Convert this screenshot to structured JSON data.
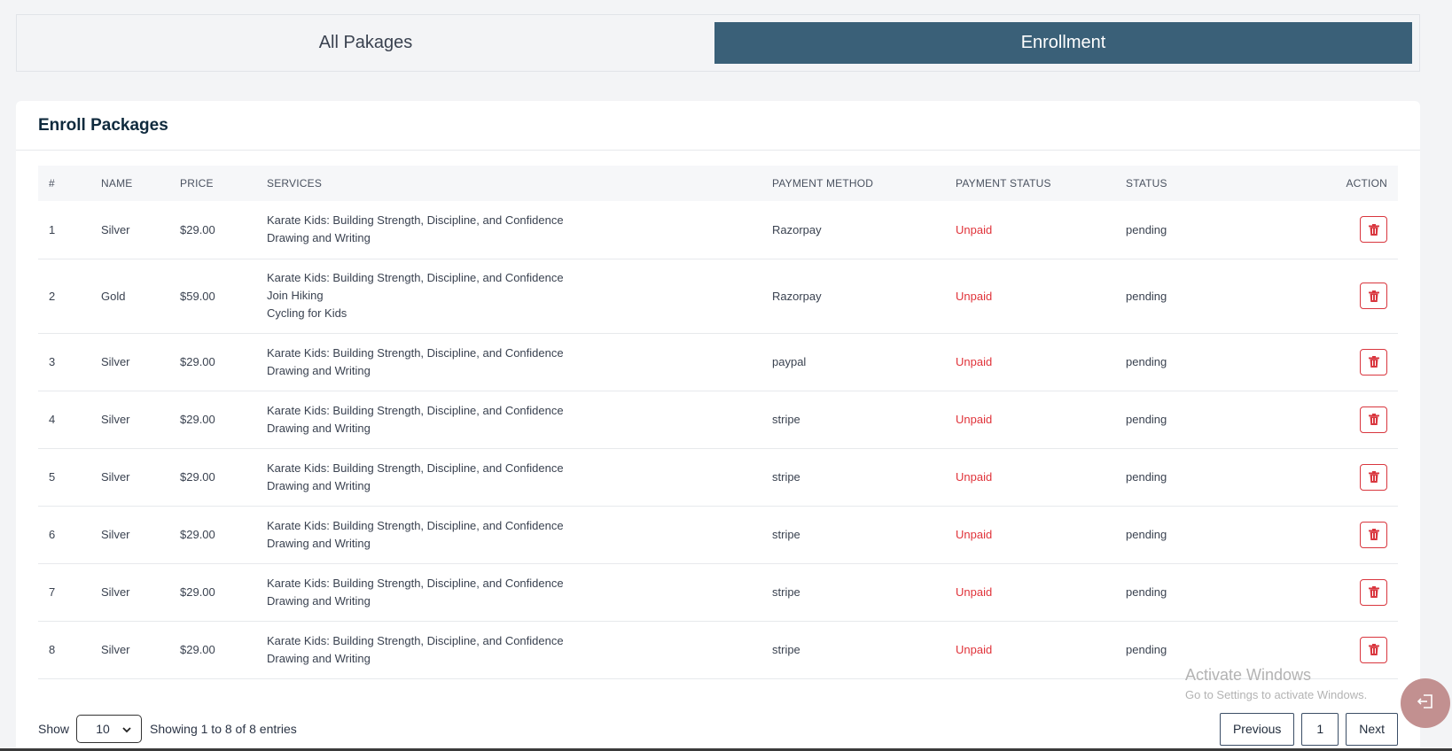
{
  "tabs": [
    {
      "label": "All Pakages",
      "active": false
    },
    {
      "label": "Enrollment",
      "active": true
    }
  ],
  "card": {
    "title": "Enroll Packages"
  },
  "table": {
    "headers": [
      "#",
      "NAME",
      "PRICE",
      "SERVICES",
      "PAYMENT METHOD",
      "PAYMENT STATUS",
      "STATUS",
      "ACTION"
    ],
    "rows": [
      {
        "num": "1",
        "name": "Silver",
        "price": "$29.00",
        "services": [
          "Karate Kids: Building Strength, Discipline, and Confidence",
          "Drawing and Writing"
        ],
        "method": "Razorpay",
        "payment_status": "Unpaid",
        "status": "pending"
      },
      {
        "num": "2",
        "name": "Gold",
        "price": "$59.00",
        "services": [
          "Karate Kids: Building Strength, Discipline, and Confidence",
          "Join Hiking",
          "Cycling for Kids"
        ],
        "method": "Razorpay",
        "payment_status": "Unpaid",
        "status": "pending"
      },
      {
        "num": "3",
        "name": "Silver",
        "price": "$29.00",
        "services": [
          "Karate Kids: Building Strength, Discipline, and Confidence",
          "Drawing and Writing"
        ],
        "method": "paypal",
        "payment_status": "Unpaid",
        "status": "pending"
      },
      {
        "num": "4",
        "name": "Silver",
        "price": "$29.00",
        "services": [
          "Karate Kids: Building Strength, Discipline, and Confidence",
          "Drawing and Writing"
        ],
        "method": "stripe",
        "payment_status": "Unpaid",
        "status": "pending"
      },
      {
        "num": "5",
        "name": "Silver",
        "price": "$29.00",
        "services": [
          "Karate Kids: Building Strength, Discipline, and Confidence",
          "Drawing and Writing"
        ],
        "method": "stripe",
        "payment_status": "Unpaid",
        "status": "pending"
      },
      {
        "num": "6",
        "name": "Silver",
        "price": "$29.00",
        "services": [
          "Karate Kids: Building Strength, Discipline, and Confidence",
          "Drawing and Writing"
        ],
        "method": "stripe",
        "payment_status": "Unpaid",
        "status": "pending"
      },
      {
        "num": "7",
        "name": "Silver",
        "price": "$29.00",
        "services": [
          "Karate Kids: Building Strength, Discipline, and Confidence",
          "Drawing and Writing"
        ],
        "method": "stripe",
        "payment_status": "Unpaid",
        "status": "pending"
      },
      {
        "num": "8",
        "name": "Silver",
        "price": "$29.00",
        "services": [
          "Karate Kids: Building Strength, Discipline, and Confidence",
          "Drawing and Writing"
        ],
        "method": "stripe",
        "payment_status": "Unpaid",
        "status": "pending"
      }
    ],
    "action_icon": "trash-icon"
  },
  "footer": {
    "show_label": "Show",
    "page_size": "10",
    "info": "Showing 1 to 8 of 8 entries",
    "prev_label": "Previous",
    "current_page": "1",
    "next_label": "Next"
  },
  "watermark": {
    "line1": "Activate Windows",
    "line2": "Go to Settings to activate Windows."
  },
  "colors": {
    "accent": "#3a6078",
    "danger": "#e0333a",
    "fab": "#c29090"
  },
  "icons": {
    "fab": "logout-icon",
    "select": "chevron-down-icon"
  }
}
